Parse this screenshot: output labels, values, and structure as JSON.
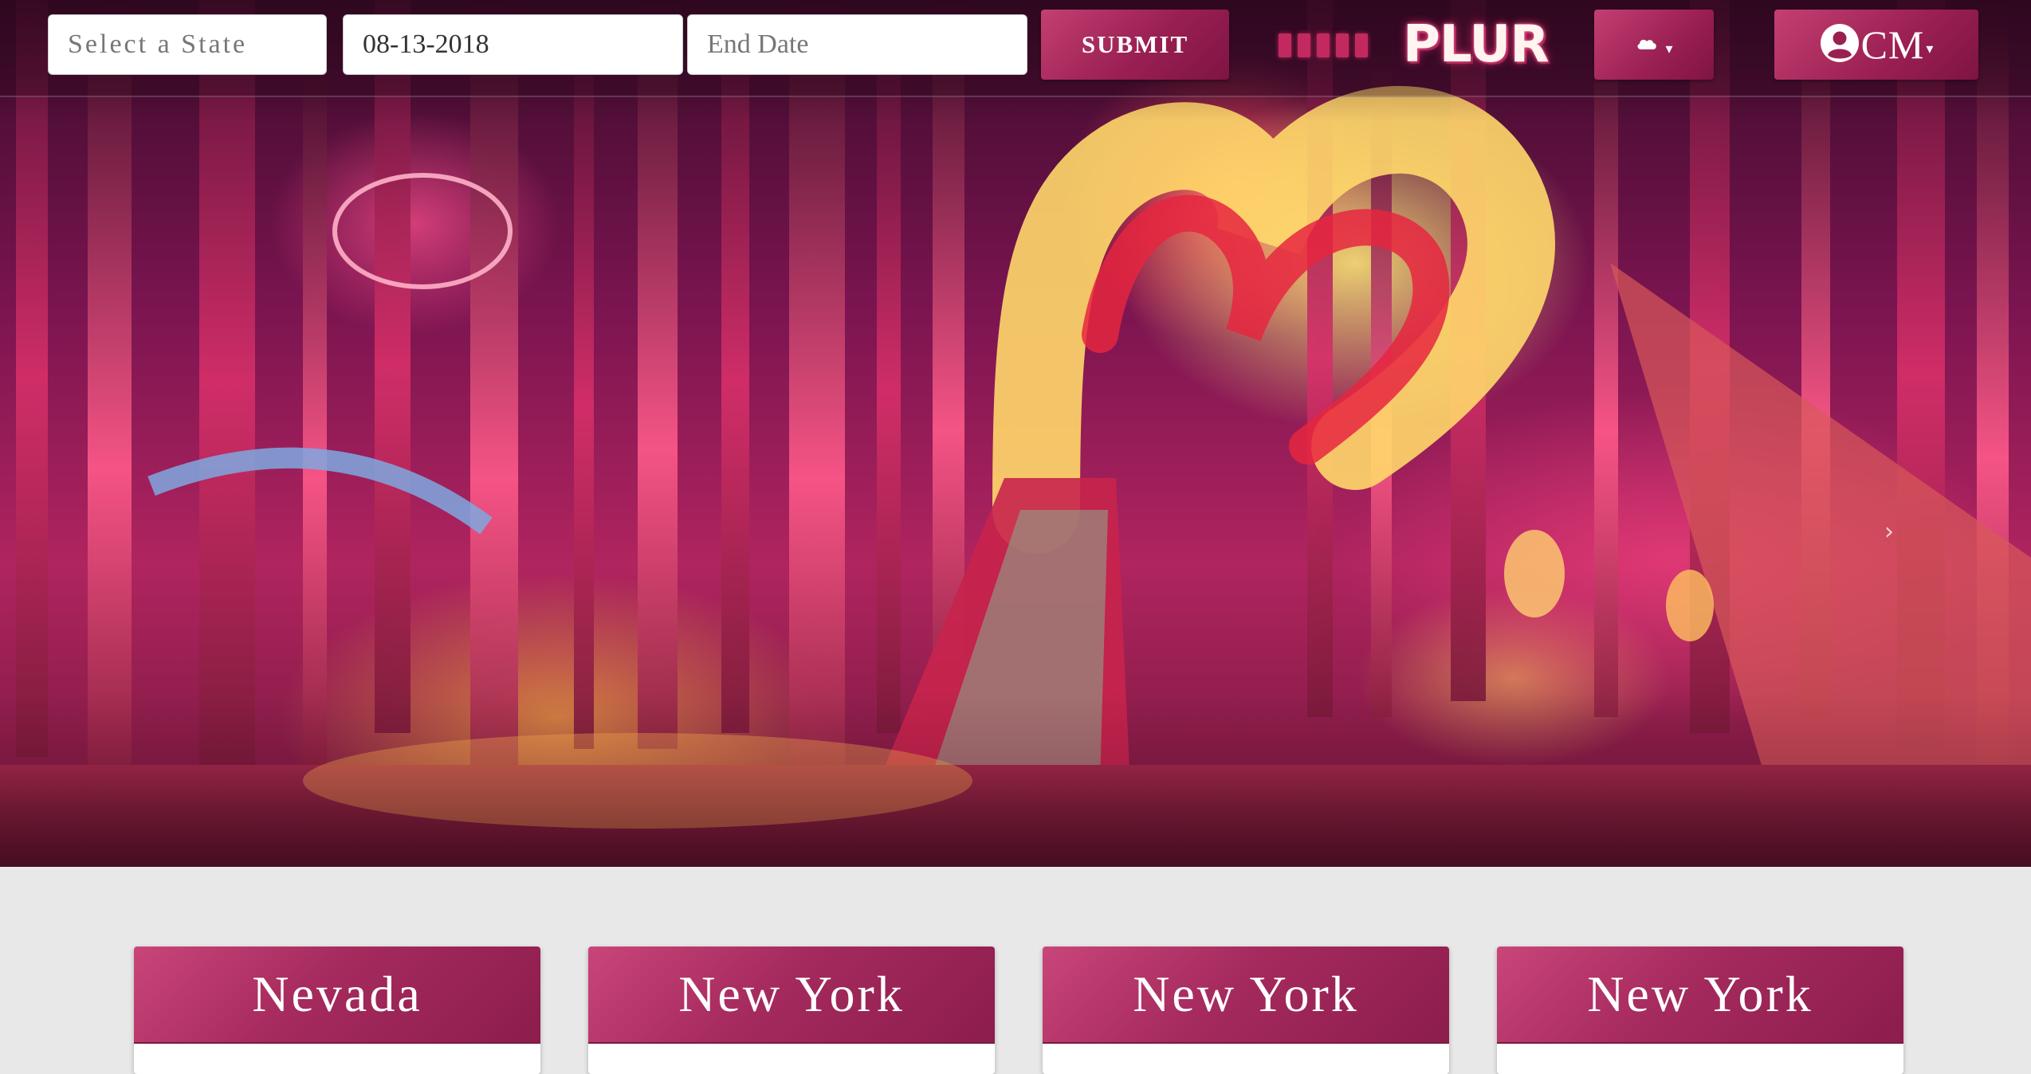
{
  "navbar": {
    "state_select": {
      "placeholder": "Select a State"
    },
    "start_date": {
      "value": "08-13-2018"
    },
    "end_date": {
      "placeholder": "End Date"
    },
    "submit_label": "SUBMIT",
    "brand": "PLUR",
    "weather_icon": "cloud-icon",
    "profile_icon": "user-circle-icon",
    "profile_initials": "CM"
  },
  "hero": {
    "next_arrow": "›"
  },
  "cards": [
    {
      "title": "Nevada"
    },
    {
      "title": "New York"
    },
    {
      "title": "New York"
    },
    {
      "title": "New York"
    }
  ],
  "colors": {
    "accent": "#a52a5d",
    "accent_light": "#c9457a",
    "page_bg": "#e8e8e8"
  }
}
